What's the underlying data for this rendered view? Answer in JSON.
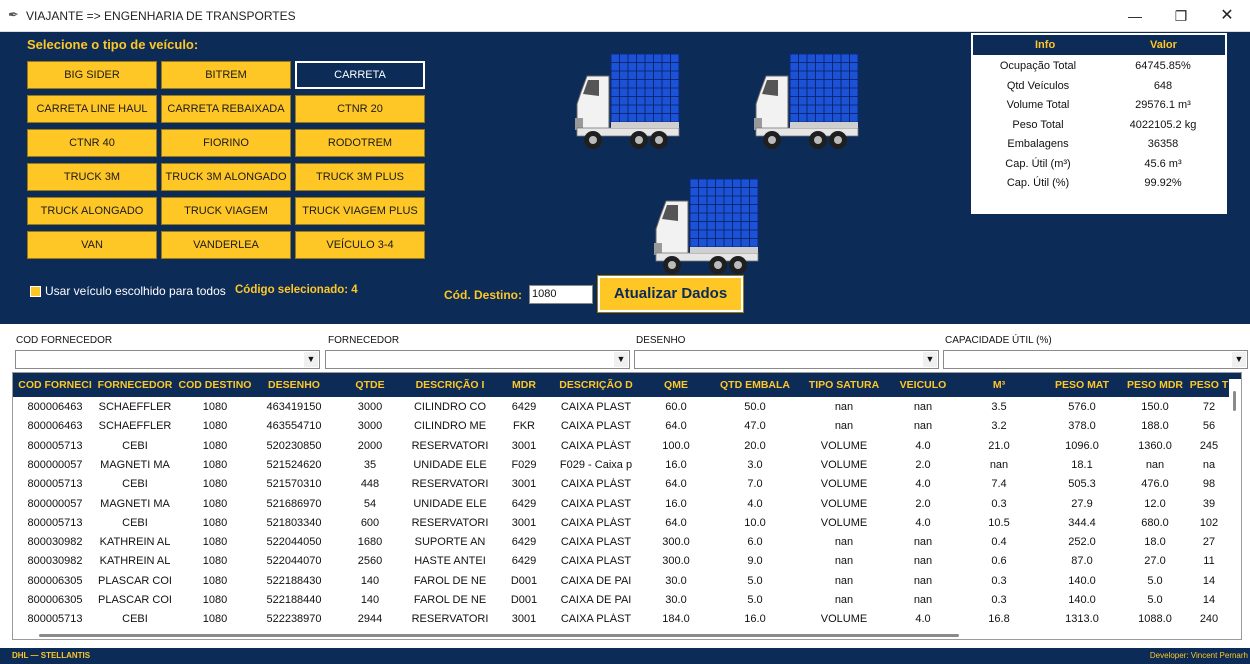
{
  "window": {
    "title": "VIAJANTE => ENGENHARIA DE TRANSPORTES",
    "min_glyph": "—",
    "max_glyph": "❐",
    "close_glyph": "✕",
    "icon": "feather-icon"
  },
  "vehicle_panel": {
    "title": "Selecione o tipo de veículo:",
    "buttons": [
      {
        "label": "BIG SIDER"
      },
      {
        "label": "BITREM"
      },
      {
        "label": "CARRETA"
      },
      {
        "label": "CARRETA LINE HAUL"
      },
      {
        "label": "CARRETA REBAIXADA"
      },
      {
        "label": "CTNR 20"
      },
      {
        "label": "CTNR 40"
      },
      {
        "label": "FIORINO"
      },
      {
        "label": "RODOTREM"
      },
      {
        "label": "TRUCK 3M"
      },
      {
        "label": "TRUCK 3M ALONGADO"
      },
      {
        "label": "TRUCK 3M PLUS"
      },
      {
        "label": "TRUCK ALONGADO"
      },
      {
        "label": "TRUCK VIAGEM"
      },
      {
        "label": "TRUCK VIAGEM PLUS"
      },
      {
        "label": "VAN"
      },
      {
        "label": "VANDERLEA"
      },
      {
        "label": "VEÍCULO 3-4"
      }
    ],
    "selected": "CARRETA",
    "use_for_all_label": "Usar veículo escolhido para todos",
    "use_for_all_checked": true,
    "selected_code_text": "Código selecionado: 4"
  },
  "destination": {
    "label": "Cód. Destino:",
    "value": "1080",
    "update_button": "Atualizar Dados"
  },
  "info_table": {
    "headers": [
      "Info",
      "Valor"
    ],
    "rows": [
      {
        "key": "Ocupação Total",
        "value": "64745.85%"
      },
      {
        "key": "Qtd Veículos",
        "value": "648"
      },
      {
        "key": "Volume Total",
        "value": "29576.1 m³"
      },
      {
        "key": "Peso Total",
        "value": "4022105.2 kg"
      },
      {
        "key": "Embalagens",
        "value": "36358"
      },
      {
        "key": "Cap. Útil (m³)",
        "value": "45.6 m³"
      },
      {
        "key": "Cap. Útil (%)",
        "value": "99.92%"
      }
    ]
  },
  "colors": {
    "navy": "#0c2b57",
    "yellow": "#ffc726",
    "truck_cargo": "#1c52d6"
  },
  "filters": [
    {
      "label": "COD FORNECEDOR",
      "value": ""
    },
    {
      "label": "FORNECEDOR",
      "value": ""
    },
    {
      "label": "DESENHO",
      "value": ""
    },
    {
      "label": "CAPACIDADE ÚTIL (%)",
      "value": ""
    }
  ],
  "table": {
    "columns": [
      "COD FORNECI",
      "FORNECEDOR",
      "COD DESTINO",
      "DESENHO",
      "QTDE",
      "DESCRIÇÃO I",
      "MDR",
      "DESCRIÇÃO D",
      "QME",
      "QTD EMBALA",
      "TIPO SATURA",
      "VEICULO",
      "M³",
      "PESO MAT",
      "PESO MDR",
      "PESO T"
    ],
    "rows": [
      [
        "800006463",
        "SCHAEFFLER",
        "1080",
        "463419150",
        "3000",
        "CILINDRO CO",
        "6429",
        "CAIXA PLAST",
        "60.0",
        "50.0",
        "nan",
        "nan",
        "3.5",
        "576.0",
        "150.0",
        "72"
      ],
      [
        "800006463",
        "SCHAEFFLER",
        "1080",
        "463554710",
        "3000",
        "CILINDRO ME",
        "FKR",
        "CAIXA PLAST",
        "64.0",
        "47.0",
        "nan",
        "nan",
        "3.2",
        "378.0",
        "188.0",
        "56"
      ],
      [
        "800005713",
        "CEBI",
        "1080",
        "520230850",
        "2000",
        "RESERVATORI",
        "3001",
        "CAIXA PLÁST",
        "100.0",
        "20.0",
        "VOLUME",
        "4.0",
        "21.0",
        "1096.0",
        "1360.0",
        "245"
      ],
      [
        "800000057",
        "MAGNETI MA",
        "1080",
        "521524620",
        "35",
        "UNIDADE ELE",
        "F029",
        "F029 - Caixa p",
        "16.0",
        "3.0",
        "VOLUME",
        "2.0",
        "nan",
        "18.1",
        "nan",
        "na"
      ],
      [
        "800005713",
        "CEBI",
        "1080",
        "521570310",
        "448",
        "RESERVATORI",
        "3001",
        "CAIXA PLÁST",
        "64.0",
        "7.0",
        "VOLUME",
        "4.0",
        "7.4",
        "505.3",
        "476.0",
        "98"
      ],
      [
        "800000057",
        "MAGNETI MA",
        "1080",
        "521686970",
        "54",
        "UNIDADE ELE",
        "6429",
        "CAIXA PLAST",
        "16.0",
        "4.0",
        "VOLUME",
        "2.0",
        "0.3",
        "27.9",
        "12.0",
        "39"
      ],
      [
        "800005713",
        "CEBI",
        "1080",
        "521803340",
        "600",
        "RESERVATORI",
        "3001",
        "CAIXA PLÁST",
        "64.0",
        "10.0",
        "VOLUME",
        "4.0",
        "10.5",
        "344.4",
        "680.0",
        "102"
      ],
      [
        "800030982",
        "KATHREIN AL",
        "1080",
        "522044050",
        "1680",
        "SUPORTE AN",
        "6429",
        "CAIXA PLAST",
        "300.0",
        "6.0",
        "nan",
        "nan",
        "0.4",
        "252.0",
        "18.0",
        "27"
      ],
      [
        "800030982",
        "KATHREIN AL",
        "1080",
        "522044070",
        "2560",
        "HASTE ANTEI",
        "6429",
        "CAIXA PLAST",
        "300.0",
        "9.0",
        "nan",
        "nan",
        "0.6",
        "87.0",
        "27.0",
        "11"
      ],
      [
        "800006305",
        "PLASCAR COI",
        "1080",
        "522188430",
        "140",
        "FAROL DE NE",
        "D001",
        "CAIXA DE PAI",
        "30.0",
        "5.0",
        "nan",
        "nan",
        "0.3",
        "140.0",
        "5.0",
        "14"
      ],
      [
        "800006305",
        "PLASCAR COI",
        "1080",
        "522188440",
        "140",
        "FAROL DE NE",
        "D001",
        "CAIXA DE PAI",
        "30.0",
        "5.0",
        "nan",
        "nan",
        "0.3",
        "140.0",
        "5.0",
        "14"
      ],
      [
        "800005713",
        "CEBI",
        "1080",
        "522238970",
        "2944",
        "RESERVATORI",
        "3001",
        "CAIXA PLÁST",
        "184.0",
        "16.0",
        "VOLUME",
        "4.0",
        "16.8",
        "1313.0",
        "1088.0",
        "240"
      ]
    ]
  },
  "footer": {
    "left": "DHL — STELLANTIS",
    "right": "Developer: Vincent Pernarh"
  }
}
